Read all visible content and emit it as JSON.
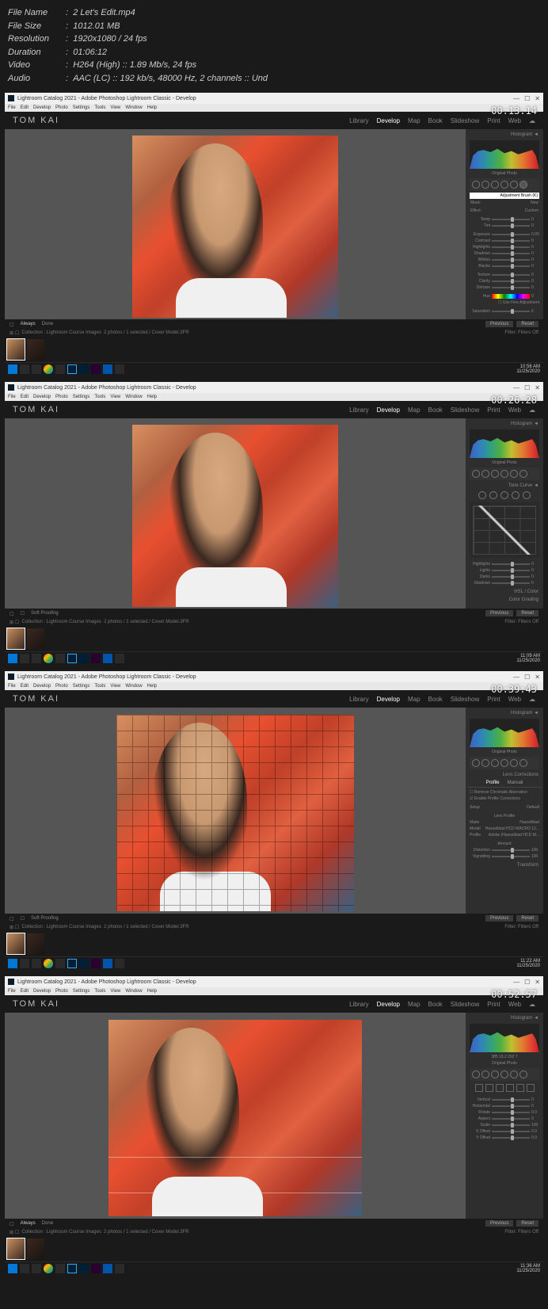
{
  "fileinfo": {
    "name_label": "File Name",
    "name": "2 Let's Edit.mp4",
    "size_label": "File Size",
    "size": "1012.01 MB",
    "resolution_label": "Resolution",
    "resolution": "1920x1080 / 24 fps",
    "duration_label": "Duration",
    "duration": "01:06:12",
    "video_label": "Video",
    "video": "H264 (High) :: 1.89 Mb/s, 24 fps",
    "audio_label": "Audio",
    "audio": "AAC (LC) :: 192 kb/s, 48000 Hz, 2 channels :: Und"
  },
  "window_title": "Lightroom Catalog 2021 - Adobe Photoshop Lightroom Classic - Develop",
  "menu_items": [
    "File",
    "Edit",
    "Develop",
    "Photo",
    "Settings",
    "Tools",
    "View",
    "Window",
    "Help"
  ],
  "brand": "TOM KAI",
  "modules": [
    "Library",
    "Develop",
    "Map",
    "Book",
    "Slideshow",
    "Print",
    "Web"
  ],
  "active_module": "Develop",
  "timestamps": [
    "00:13:14",
    "00:26:28",
    "00:39:43",
    "00:52:57"
  ],
  "panel_headers": {
    "histogram": "Histogram ◄",
    "tone_curve": "Tone Curve ◄",
    "hsl": "HSL / Color",
    "color_grading": "Color Grading",
    "lens": "Lens Corrections",
    "transform": "Transform"
  },
  "sliders_brush": [
    {
      "label": "Temp",
      "val": "0"
    },
    {
      "label": "Tint",
      "val": "0"
    },
    {
      "label": "Exposure",
      "val": "0.00"
    },
    {
      "label": "Contrast",
      "val": "0"
    },
    {
      "label": "Highlights",
      "val": "0"
    },
    {
      "label": "Shadows",
      "val": "0"
    },
    {
      "label": "Whites",
      "val": "0"
    },
    {
      "label": "Blacks",
      "val": "0"
    },
    {
      "label": "Texture",
      "val": "0"
    },
    {
      "label": "Clarity",
      "val": "0"
    },
    {
      "label": "Dehaze",
      "val": "0"
    },
    {
      "label": "Saturation",
      "val": "0"
    }
  ],
  "sliders_tone": [
    {
      "label": "Highlights",
      "val": "0"
    },
    {
      "label": "Lights",
      "val": "0"
    },
    {
      "label": "Darks",
      "val": "0"
    },
    {
      "label": "Shadows",
      "val": "0"
    }
  ],
  "lens_tabs": [
    "Profile",
    "Manual"
  ],
  "lens_options": {
    "remove_ca": "Remove Chromatic Aberration",
    "enable_profile": "Enable Profile Corrections",
    "setup": "Setup",
    "setup_val": "Default",
    "lens_profile": "Lens Profile",
    "make": "Make",
    "make_val": "Hasselblad",
    "model": "Model",
    "model_val": "Hasselblad HCD MACRO 12...",
    "profile": "Profile",
    "profile_val": "Adobe (Hasselblad HCD M...",
    "amount": "Amount",
    "distortion": "Distortion",
    "vignetting": "Vignetting"
  },
  "transform_sliders": [
    {
      "label": "Vertical",
      "val": "0"
    },
    {
      "label": "Horizontal",
      "val": "0"
    },
    {
      "label": "Rotate",
      "val": "0.0"
    },
    {
      "label": "Aspect",
      "val": "0"
    },
    {
      "label": "Scale",
      "val": "100"
    },
    {
      "label": "X Offset",
      "val": "0.0"
    },
    {
      "label": "Y Offset",
      "val": "0.0"
    }
  ],
  "toolbar_soft": "Soft Proofing",
  "toolbar_done": "Done",
  "toolbar_always": "Always",
  "btn_prev": "Previous",
  "btn_reset": "Reset",
  "info_collection": "Collection : Lightroom Course Images",
  "info_photos": "2 photos / 1 selected / Cover Model.3FR",
  "filter": "Filter:",
  "filters_off": "Filters Off",
  "tooltip_brush": "Adjustment Brush (K)",
  "brush_header": "Effect:",
  "brush_custom": "Custom",
  "brush_mask": "Mask:",
  "brush_new": "New",
  "fine_adjustment": "Use Fine Adjustment",
  "hue_label": "Hue",
  "original_photo": "Original Photo",
  "clocks": [
    {
      "time": "10:56 AM",
      "date": "11/25/2020"
    },
    {
      "time": "11:09 AM",
      "date": "11/25/2020"
    },
    {
      "time": "11:22 AM",
      "date": "11/25/2020"
    },
    {
      "time": "11:36 AM",
      "date": "11/25/2020"
    }
  ],
  "hist_values": "385   15.2   292   7"
}
